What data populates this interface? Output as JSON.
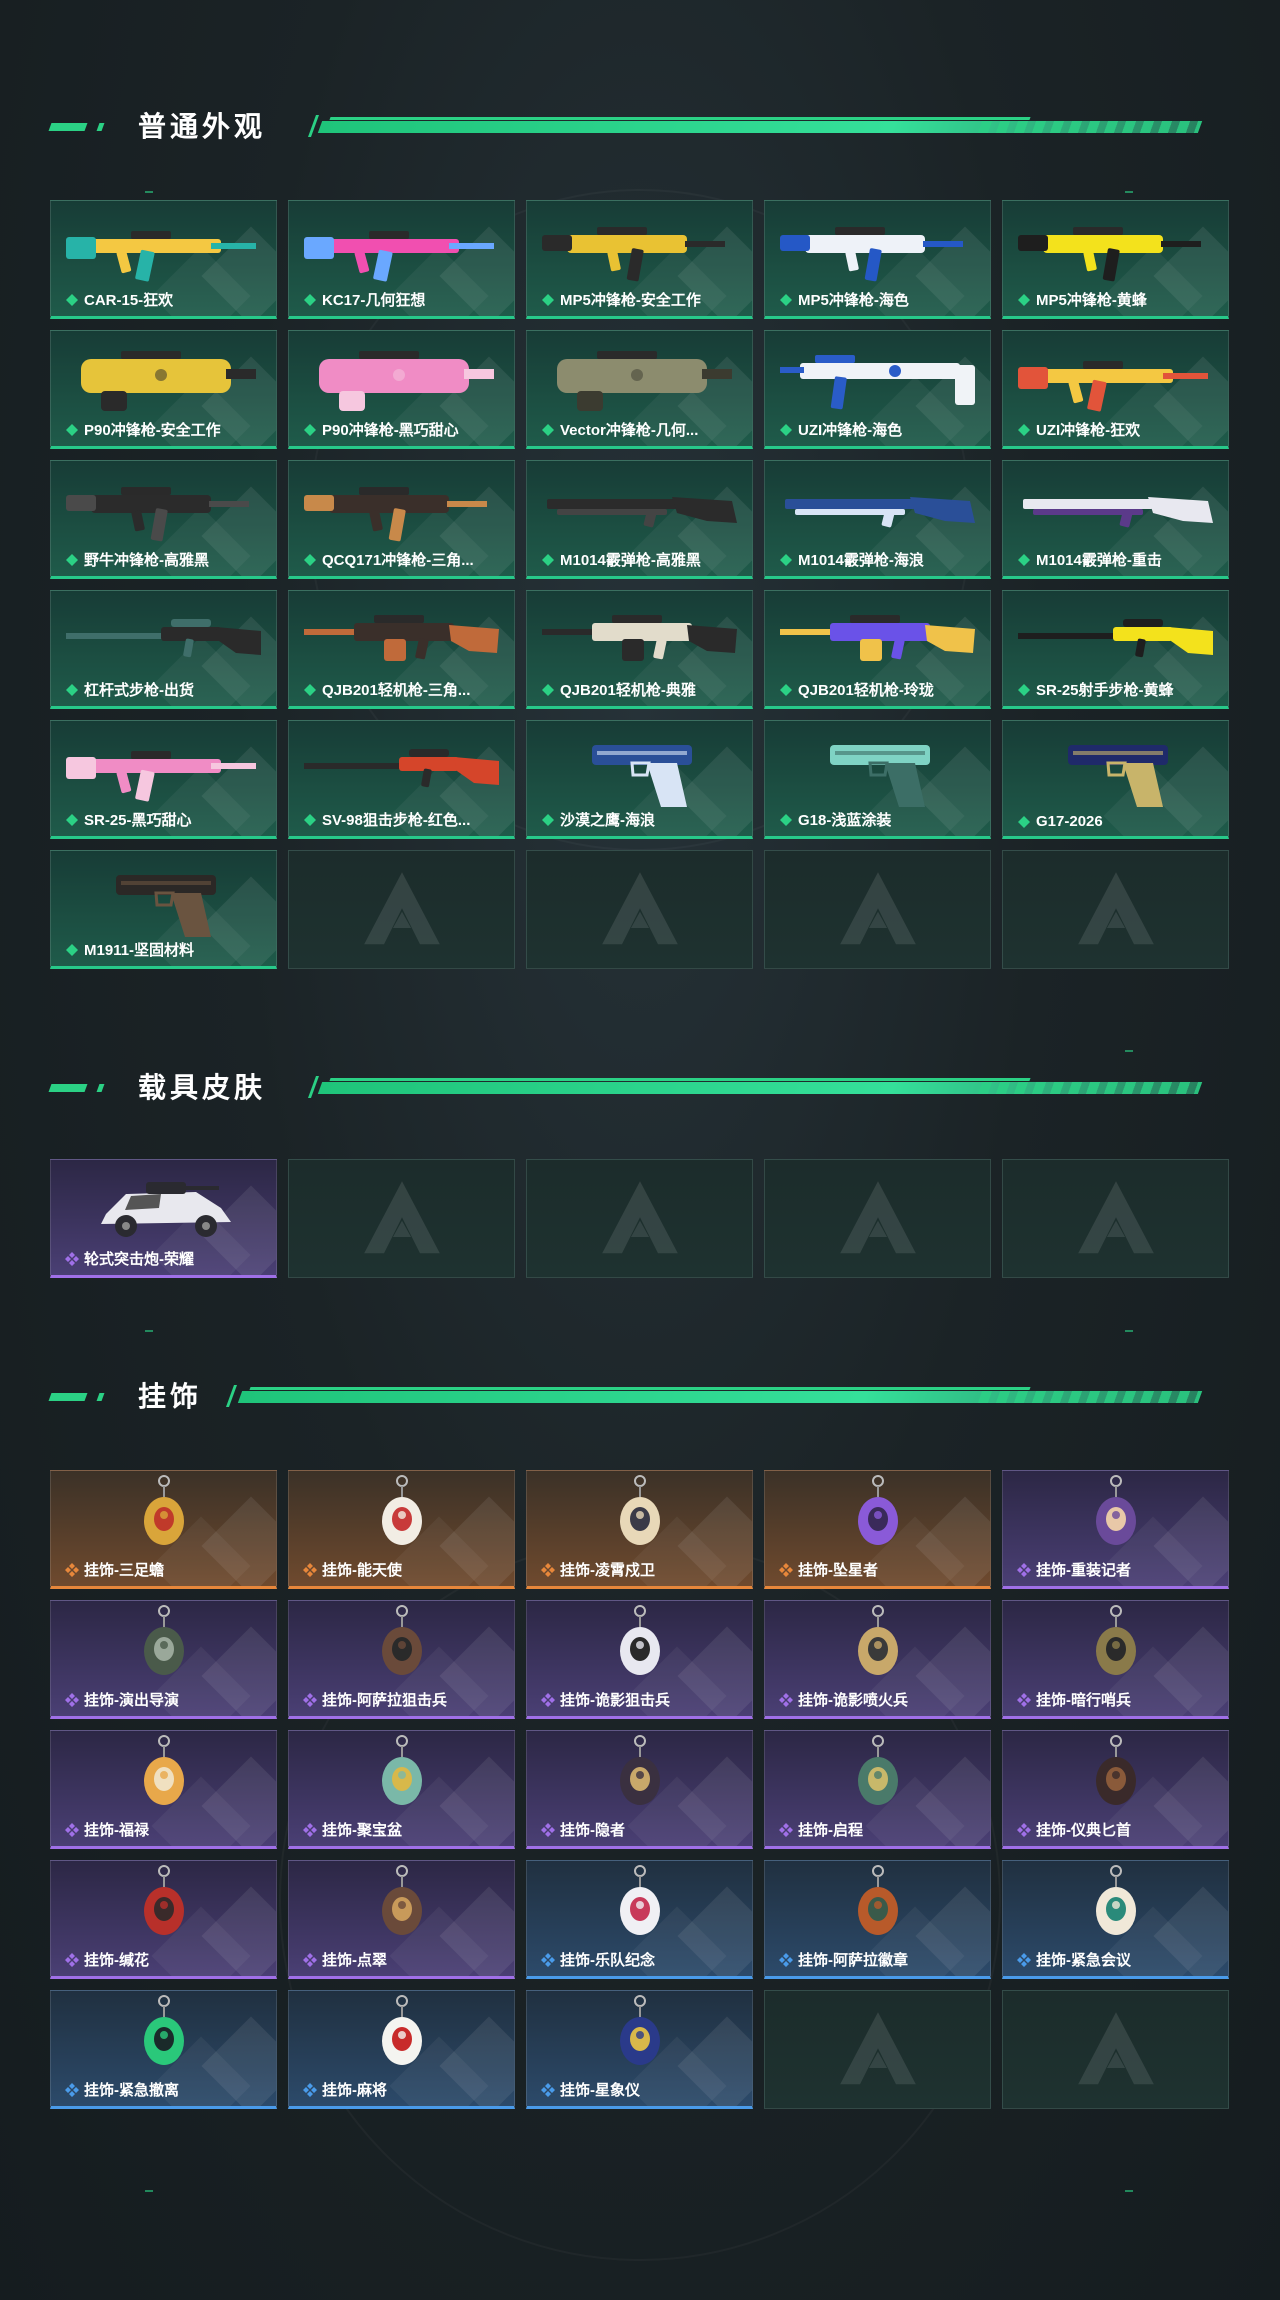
{
  "colors": {
    "accent": "#2bd185",
    "weapon_green": "#27c98a",
    "purple": "#a070e8",
    "orange": "#e7873b",
    "blue": "#4a9bea"
  },
  "sections": [
    {
      "title": "普通外观",
      "items": [
        {
          "label": "CAR-15-狂欢",
          "rarity": "green",
          "icon": "assault-rifle",
          "primary": "#f4c842",
          "secondary": "#27b3a8"
        },
        {
          "label": "KC17-几何狂想",
          "rarity": "green",
          "icon": "assault-rifle",
          "primary": "#f14fb0",
          "secondary": "#6aa8ff"
        },
        {
          "label": "MP5冲锋枪-安全工作",
          "rarity": "green",
          "icon": "smg",
          "primary": "#e9c233",
          "secondary": "#2a2a2a"
        },
        {
          "label": "MP5冲锋枪-海色",
          "rarity": "green",
          "icon": "smg",
          "primary": "#eef2f8",
          "secondary": "#2558c6"
        },
        {
          "label": "MP5冲锋枪-黄蜂",
          "rarity": "green",
          "icon": "smg",
          "primary": "#f3e21c",
          "secondary": "#1e1e1e"
        },
        {
          "label": "P90冲锋枪-安全工作",
          "rarity": "green",
          "icon": "bullpup",
          "primary": "#e6c43a",
          "secondary": "#2a2a2a"
        },
        {
          "label": "P90冲锋枪-黑巧甜心",
          "rarity": "green",
          "icon": "bullpup",
          "primary": "#f08cc5",
          "secondary": "#f6c7df"
        },
        {
          "label": "Vector冲锋枪-几何...",
          "rarity": "green",
          "icon": "bullpup",
          "primary": "#8c8c6e",
          "secondary": "#3b3b30"
        },
        {
          "label": "UZI冲锋枪-海色",
          "rarity": "green",
          "icon": "rifle",
          "primary": "#f0f3f7",
          "secondary": "#2a5cc8"
        },
        {
          "label": "UZI冲锋枪-狂欢",
          "rarity": "green",
          "icon": "assault-rifle",
          "primary": "#f4c842",
          "secondary": "#e2543a"
        },
        {
          "label": "野牛冲锋枪-高雅黑",
          "rarity": "green",
          "icon": "smg",
          "primary": "#2b2b2b",
          "secondary": "#4a4a4a"
        },
        {
          "label": "QCQ171冲锋枪-三角...",
          "rarity": "green",
          "icon": "smg",
          "primary": "#3a2f2a",
          "secondary": "#c8894a"
        },
        {
          "label": "M1014霰弹枪-高雅黑",
          "rarity": "green",
          "icon": "shotgun",
          "primary": "#2b2b2b",
          "secondary": "#444"
        },
        {
          "label": "M1014霰弹枪-海浪",
          "rarity": "green",
          "icon": "shotgun",
          "primary": "#2a4f98",
          "secondary": "#d8e4f5"
        },
        {
          "label": "M1014霰弹枪-重击",
          "rarity": "green",
          "icon": "shotgun",
          "primary": "#e8e8f0",
          "secondary": "#5b3a8a"
        },
        {
          "label": "杠杆式步枪-出货",
          "rarity": "green",
          "icon": "sniper",
          "primary": "#2a2a2a",
          "secondary": "#3f6e6a"
        },
        {
          "label": "QJB201轻机枪-三角...",
          "rarity": "green",
          "icon": "lmg",
          "primary": "#3a2f2a",
          "secondary": "#c06a3a"
        },
        {
          "label": "QJB201轻机枪-典雅",
          "rarity": "green",
          "icon": "lmg",
          "primary": "#e2dccb",
          "secondary": "#2a2a2a"
        },
        {
          "label": "QJB201轻机枪-玲珑",
          "rarity": "green",
          "icon": "lmg",
          "primary": "#6a52e8",
          "secondary": "#f0c24a"
        },
        {
          "label": "SR-25射手步枪-黄蜂",
          "rarity": "green",
          "icon": "sniper",
          "primary": "#f3e21c",
          "secondary": "#1e1e1e"
        },
        {
          "label": "SR-25-黑巧甜心",
          "rarity": "green",
          "icon": "assault-rifle",
          "primary": "#f08cc5",
          "secondary": "#f6c7df"
        },
        {
          "label": "SV-98狙击步枪-红色...",
          "rarity": "green",
          "icon": "sniper",
          "primary": "#d5452a",
          "secondary": "#2a2a2a"
        },
        {
          "label": "沙漠之鹰-海浪",
          "rarity": "green",
          "icon": "pistol",
          "primary": "#2a4f98",
          "secondary": "#d8e4f5"
        },
        {
          "label": "G18-浅蓝涂装",
          "rarity": "green",
          "icon": "pistol",
          "primary": "#7fd3c4",
          "secondary": "#3c6e66"
        },
        {
          "label": "G17-2026",
          "rarity": "green",
          "icon": "pistol",
          "primary": "#1f2a6a",
          "secondary": "#c8b46a"
        },
        {
          "label": "M1911-坚固材料",
          "rarity": "green",
          "icon": "pistol",
          "primary": "#2b2826",
          "secondary": "#6a5440"
        },
        {
          "label": "",
          "rarity": "empty"
        },
        {
          "label": "",
          "rarity": "empty"
        },
        {
          "label": "",
          "rarity": "empty"
        },
        {
          "label": "",
          "rarity": "empty"
        }
      ]
    },
    {
      "title": "载具皮肤",
      "items": [
        {
          "label": "轮式突击炮-荣耀",
          "rarity": "purple",
          "icon": "vehicle",
          "primary": "#e8e8ee",
          "secondary": "#2a2a30"
        },
        {
          "label": "",
          "rarity": "empty"
        },
        {
          "label": "",
          "rarity": "empty"
        },
        {
          "label": "",
          "rarity": "empty"
        },
        {
          "label": "",
          "rarity": "empty"
        }
      ]
    },
    {
      "title": "挂饰",
      "items": [
        {
          "label": "挂饰-三足蟾",
          "rarity": "orange",
          "icon": "charm",
          "primary": "#d9a53a",
          "secondary": "#c03a2a"
        },
        {
          "label": "挂饰-能天使",
          "rarity": "orange",
          "icon": "charm",
          "primary": "#f2ede4",
          "secondary": "#c83a3a"
        },
        {
          "label": "挂饰-凌霄戍卫",
          "rarity": "orange",
          "icon": "charm",
          "primary": "#e8d8b8",
          "secondary": "#3a3a48"
        },
        {
          "label": "挂饰-坠星者",
          "rarity": "orange",
          "icon": "charm",
          "primary": "#8a5ad8",
          "secondary": "#3a2a5a"
        },
        {
          "label": "挂饰-重装记者",
          "rarity": "purple",
          "icon": "charm",
          "primary": "#6a4a9a",
          "secondary": "#e8c8a8"
        },
        {
          "label": "挂饰-演出导演",
          "rarity": "purple",
          "icon": "charm",
          "primary": "#4a5a4a",
          "secondary": "#9aa89a"
        },
        {
          "label": "挂饰-阿萨拉狙击兵",
          "rarity": "purple",
          "icon": "charm",
          "primary": "#6a4a3a",
          "secondary": "#2a2a2a"
        },
        {
          "label": "挂饰-诡影狙击兵",
          "rarity": "purple",
          "icon": "charm",
          "primary": "#e8e8f0",
          "secondary": "#2a2a2a"
        },
        {
          "label": "挂饰-诡影喷火兵",
          "rarity": "purple",
          "icon": "charm",
          "primary": "#c8a86a",
          "secondary": "#3a3a3a"
        },
        {
          "label": "挂饰-暗行哨兵",
          "rarity": "purple",
          "icon": "charm",
          "primary": "#8a7a4a",
          "secondary": "#2a2a2a"
        },
        {
          "label": "挂饰-福禄",
          "rarity": "purple",
          "icon": "charm",
          "primary": "#e8a84a",
          "secondary": "#f0e0c0"
        },
        {
          "label": "挂饰-聚宝盆",
          "rarity": "purple",
          "icon": "charm",
          "primary": "#7ab8a8",
          "secondary": "#d8b84a"
        },
        {
          "label": "挂饰-隐者",
          "rarity": "purple",
          "icon": "charm",
          "primary": "#3a3040",
          "secondary": "#c8a86a"
        },
        {
          "label": "挂饰-启程",
          "rarity": "purple",
          "icon": "charm",
          "primary": "#4a7a6a",
          "secondary": "#c8b86a"
        },
        {
          "label": "挂饰-仪典匕首",
          "rarity": "purple",
          "icon": "charm",
          "primary": "#3a2a2a",
          "secondary": "#8a5a3a"
        },
        {
          "label": "挂饰-缄花",
          "rarity": "purple",
          "icon": "charm",
          "primary": "#b8302a",
          "secondary": "#3a2a2a"
        },
        {
          "label": "挂饰-点翠",
          "rarity": "purple",
          "icon": "charm",
          "primary": "#6a4a3a",
          "secondary": "#c89a5a"
        },
        {
          "label": "挂饰-乐队纪念",
          "rarity": "blue",
          "icon": "charm",
          "primary": "#f0f0f4",
          "secondary": "#c83a5a"
        },
        {
          "label": "挂饰-阿萨拉徽章",
          "rarity": "blue",
          "icon": "charm",
          "primary": "#b85a2a",
          "secondary": "#3a5a4a"
        },
        {
          "label": "挂饰-紧急会议",
          "rarity": "blue",
          "icon": "charm",
          "primary": "#f0e8d8",
          "secondary": "#2a8a7a"
        },
        {
          "label": "挂饰-紧急撤离",
          "rarity": "blue",
          "icon": "charm",
          "primary": "#2ac87a",
          "secondary": "#1a2a2a"
        },
        {
          "label": "挂饰-麻将",
          "rarity": "blue",
          "icon": "charm",
          "primary": "#f4f4f0",
          "secondary": "#c82a2a"
        },
        {
          "label": "挂饰-星象仪",
          "rarity": "blue",
          "icon": "charm",
          "primary": "#2a3a8a",
          "secondary": "#d8b84a"
        },
        {
          "label": "",
          "rarity": "empty"
        },
        {
          "label": "",
          "rarity": "empty"
        }
      ]
    }
  ]
}
